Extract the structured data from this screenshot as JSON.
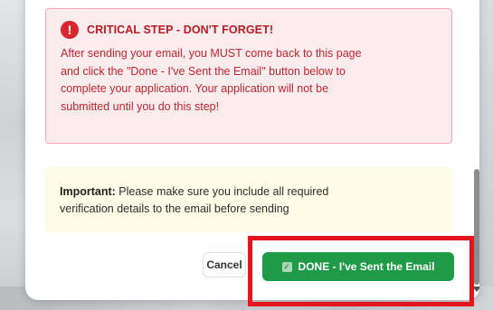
{
  "critical": {
    "icon": "alert-circle-icon",
    "title": "CRITICAL STEP - DON'T FORGET!",
    "line1": "After sending your email, you MUST come back to this page",
    "line2": "and click the \"Done - I've Sent the Email\" button below to",
    "line3": "complete your application. Your application will not be",
    "line4": "submitted until you do this step!"
  },
  "important": {
    "label": "Important:",
    "line1": " Please make sure you include all required",
    "line2": "verification details to the email before sending"
  },
  "buttons": {
    "cancel": "Cancel",
    "done": "DONE - I've Sent the Email",
    "done_icon": "checkbox-icon"
  },
  "colors": {
    "critical_bg": "#fdecee",
    "critical_text": "#c1262e",
    "important_bg": "#fefbe6",
    "done_bg": "#1f9a47",
    "highlight": "#e3141b"
  }
}
